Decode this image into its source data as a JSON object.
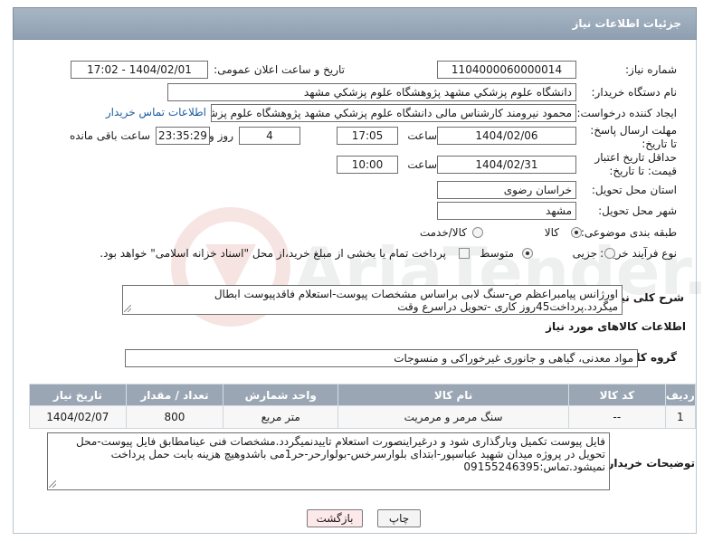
{
  "header": {
    "title": "جزئیات اطلاعات نیاز"
  },
  "form": {
    "need_number_label": "شماره نیاز:",
    "need_number": "1104000060000014",
    "announce_label": "تاریخ و ساعت اعلان عمومی:",
    "announce_value": "1404/02/01 - 17:02",
    "buyer_org_label": "نام دستگاه خریدار:",
    "buyer_org": "دانشگاه علوم پزشکي مشهد   پژوهشگاه علوم پزشکي مشهد",
    "creator_label": "ایجاد کننده درخواست:",
    "creator": "محمود نیرومند کارشناس مالی دانشگاه علوم پزشکي مشهد   پژوهشگاه علوم پزشکي مشهد",
    "contact_link": "اطلاعات تماس خریدار",
    "deadline_label": "مهلت ارسال پاسخ: تا تاریخ:",
    "deadline_date": "1404/02/06",
    "time_label": "ساعت",
    "deadline_time": "17:05",
    "days_value": "4",
    "days_label": "روز و",
    "remaining_time": "23:35:29",
    "remaining_label": "ساعت باقی مانده",
    "min_price_label": "حداقل تاریخ اعتبار قیمت: تا تاریخ:",
    "min_price_date": "1404/02/31",
    "time_label2": "ساعت",
    "min_price_time": "10:00",
    "province_label": "استان محل تحویل:",
    "province": "خراسان رضوی",
    "city_label": "شهر محل تحویل:",
    "city": "مشهد",
    "category_label": "طبقه بندی موضوعی:",
    "category_options": [
      "کالا",
      "کالا/خدمت"
    ],
    "category_selected": "کالا",
    "process_label": "نوع فرآیند خرید :",
    "process_options": [
      "جزیی",
      "متوسط"
    ],
    "process_selected": "متوسط",
    "payment_note": "پرداخت تمام یا بخشی از مبلغ خرید،از محل \"اسناد خزانه اسلامی\" خواهد بود.",
    "summary_label": "شرح کلی نیاز:",
    "summary": "اورژانس پیامبراعظم ص-سنگ لابی براساس مشخصات پیوست-استعلام فاقدپیوست ابطال میگردد.پرداخت45روز کاری -تحویل دراسرع وقت"
  },
  "goods_section": {
    "title": "اطلاعات کالاهای مورد نیاز",
    "group_label": "گروه کالا:",
    "group_value": "مواد معدنی، گیاهی و جانوری غیرخوراکی و منسوجات",
    "columns": [
      "ردیف",
      "کد کالا",
      "نام کالا",
      "واحد شمارش",
      "تعداد / مقدار",
      "تاریخ نیاز"
    ],
    "rows": [
      [
        "1",
        "--",
        "سنگ مرمر و مرمریت",
        "متر مربع",
        "800",
        "1404/02/07"
      ]
    ]
  },
  "buyer_notes": {
    "label": "توضیحات خریدار:",
    "text": "فایل پیوست تکمیل وبارگذاری شود و درغیراینصورت استعلام تاییدنمیگردد.مشخصات فنی عینامطابق فایل پیوست-محل تحویل در پروژه میدان شهید عباسپور-ابتدای بلوارسرخس-بولوارحر-حر1می باشدوهیچ هزینه بابت حمل  پرداخت نمیشود.تماس:09155246395"
  },
  "buttons": {
    "print": "چاپ",
    "back": "بازگشت"
  },
  "watermark_text": "AriaTender.neT",
  "colors": {
    "header": "#97a7b8",
    "table_header": "#9aa6b3",
    "link": "#1f5fa0",
    "back_button": "#fde8ea"
  }
}
